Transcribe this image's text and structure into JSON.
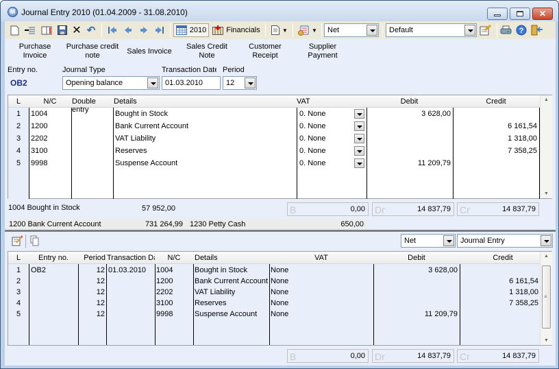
{
  "window": {
    "title": "Journal Entry 2010 (01.04.2009 - 31.08.2010)",
    "app_icon": "M",
    "close_glyph": "✕"
  },
  "toolbar": {
    "icons": [
      "new-document-icon",
      "insert-line-icon",
      "open-book-icon",
      "save-icon",
      "delete-icon",
      "undo-icon",
      "first-record-icon",
      "previous-record-icon",
      "next-record-icon",
      "last-record-icon"
    ],
    "year_button": "2010",
    "financials_button": "Financials",
    "vat_mode": "Net",
    "layout": "Default"
  },
  "shortcuts": [
    {
      "label": "Purchase\nInvoice"
    },
    {
      "label": "Purchase credit\nnote"
    },
    {
      "label": "Sales Invoice"
    },
    {
      "label": "Sales Credit\nNote"
    },
    {
      "label": "Customer\nReceipt"
    },
    {
      "label": "Supplier\nPayment"
    }
  ],
  "form": {
    "entry_no_label": "Entry no.",
    "entry_no": "OB2",
    "journal_type_label": "Journal Type",
    "journal_type": "Opening balance",
    "transaction_date_label": "Transaction Date",
    "transaction_date": "01.03.2010",
    "period_label": "Period",
    "period": "12"
  },
  "entry_grid": {
    "headers": {
      "l": "L",
      "nc": "N/C",
      "double_entry": "Double entry",
      "details": "Details",
      "vat": "VAT",
      "debit": "Debit",
      "credit": "Credit"
    },
    "rows": [
      {
        "l": "1",
        "nc": "1004",
        "details": "Bought in Stock",
        "vat": "0. None",
        "debit": "3 628,00",
        "credit": ""
      },
      {
        "l": "2",
        "nc": "1200",
        "details": "Bank Current Account",
        "vat": "0. None",
        "debit": "",
        "credit": "6 161,54"
      },
      {
        "l": "3",
        "nc": "2202",
        "details": "VAT Liability",
        "vat": "0. None",
        "debit": "",
        "credit": "1 318,00"
      },
      {
        "l": "4",
        "nc": "3100",
        "details": "Reserves",
        "vat": "0. None",
        "debit": "",
        "credit": "7 358,25"
      },
      {
        "l": "5",
        "nc": "9998",
        "details": "Suspense Account",
        "vat": "0. None",
        "debit": "11 209,79",
        "credit": ""
      }
    ]
  },
  "account_info": {
    "line1_account": "1004 Bought in Stock",
    "line1_balance": "57 952,00",
    "line2_account": "1200 Bank Current Account",
    "line2_balance": "731 264,99",
    "line2_account2": "1230 Petty Cash",
    "line2_balance2": "650,00"
  },
  "totals_top": {
    "b_label": "B",
    "b": "0,00",
    "dr_label": "Dr",
    "dr": "14 837,79",
    "cr_label": "Cr",
    "cr": "14 837,79"
  },
  "lower": {
    "vat_mode": "Net",
    "view": "Journal Entry",
    "headers": {
      "l": "L",
      "entry_no": "Entry no.",
      "period": "Period",
      "transaction_date": "Transaction Da",
      "nc": "N/C",
      "details": "Details",
      "vat": "VAT",
      "debit": "Debit",
      "credit": "Credit"
    },
    "rows": [
      {
        "l": "1",
        "entry_no": "OB2",
        "period": "12",
        "date": "01.03.2010",
        "nc": "1004",
        "details": "Bought in Stock",
        "vat": "None",
        "debit": "3 628,00",
        "credit": ""
      },
      {
        "l": "2",
        "entry_no": "",
        "period": "12",
        "date": "",
        "nc": "1200",
        "details": "Bank Current Account",
        "vat": "None",
        "debit": "",
        "credit": "6 161,54"
      },
      {
        "l": "3",
        "entry_no": "",
        "period": "12",
        "date": "",
        "nc": "2202",
        "details": "VAT Liability",
        "vat": "None",
        "debit": "",
        "credit": "1 318,00"
      },
      {
        "l": "4",
        "entry_no": "",
        "period": "12",
        "date": "",
        "nc": "3100",
        "details": "Reserves",
        "vat": "None",
        "debit": "",
        "credit": "7 358,25"
      },
      {
        "l": "5",
        "entry_no": "",
        "period": "12",
        "date": "",
        "nc": "9998",
        "details": "Suspense Account",
        "vat": "None",
        "debit": "11 209,79",
        "credit": ""
      }
    ]
  },
  "totals_bottom": {
    "b_label": "B",
    "b": "0,00",
    "dr_label": "Dr",
    "dr": "14 837,79",
    "cr_label": "Cr",
    "cr": "14 837,79"
  }
}
